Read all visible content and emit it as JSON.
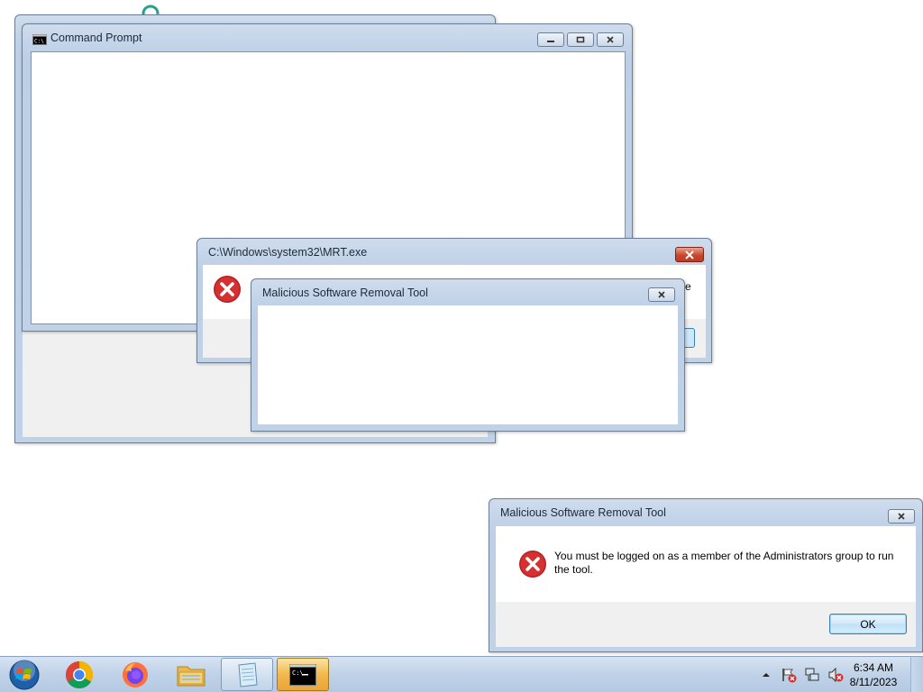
{
  "cmd_window": {
    "title": "Command Prompt"
  },
  "mrt_error": {
    "title": "C:\\Windows\\system32\\MRT.exe",
    "text_fragment": "e"
  },
  "mrt_dialog_blank": {
    "title": "Malicious Software Removal Tool"
  },
  "mrt_dialog_main": {
    "title": "Malicious Software Removal Tool",
    "message": "You must be logged on as a member of the Administrators group to run the tool.",
    "ok_label": "OK"
  },
  "taskbar": {
    "items": [
      "start-orb-icon",
      "chrome-icon",
      "firefox-icon",
      "file-explorer-icon",
      "notepad-icon",
      "command-prompt-icon"
    ],
    "tray_icons": [
      "show-hidden-icons-icon",
      "action-center-flag-icon",
      "network-icon",
      "volume-muted-icon"
    ],
    "clock": {
      "time": "6:34 AM",
      "date": "8/11/2023"
    }
  },
  "colors": {
    "error_red": "#d3262e",
    "titlebar": "#c2d3e8",
    "taskbar": "#bfd2e8",
    "active_taskbar": "#f2b84c"
  }
}
